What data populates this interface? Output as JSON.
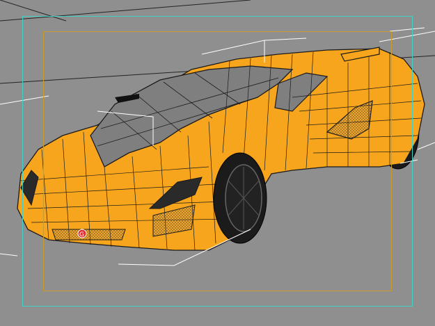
{
  "viewport": {
    "background": "#8f8f8f",
    "safe_frame_color": "#3fd0cc",
    "render_region_color": "#c99a2e"
  },
  "model": {
    "body_color": "#f7a51c",
    "wireframe_color": "#1a1a1a",
    "glass_color": "#7f7f7f",
    "tire_color": "#1b1b1b",
    "selection_bracket_color": "#ffffff",
    "badge_letter": "G"
  }
}
